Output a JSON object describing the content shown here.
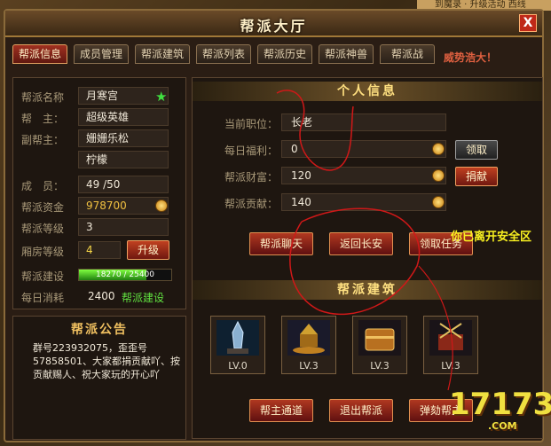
{
  "window": {
    "title": "帮派大厅",
    "close": "X"
  },
  "tabs": [
    "帮派信息",
    "成员管理",
    "帮派建筑",
    "帮派列表",
    "帮派历史",
    "帮派神兽",
    "帮派战"
  ],
  "banner_partial": "威势浩大！",
  "top_strip": "到魔录 · 升级活动 西线",
  "left": {
    "name": {
      "label": "帮派名称",
      "value": "月寒宫"
    },
    "leader": {
      "label": "帮　主：",
      "value": "超级英雄"
    },
    "vice": {
      "label": "副帮主：",
      "value1": "姗姗乐松",
      "value2": "柠檬"
    },
    "members": {
      "label": "成　员：",
      "value": "49 /50"
    },
    "funds": {
      "label": "帮派资金",
      "value": "978700"
    },
    "level": {
      "label": "帮派等级",
      "value": "3"
    },
    "room_level": {
      "label": "厢房等级",
      "value": "4",
      "button": "升级"
    },
    "construction": {
      "label": "帮派建设",
      "progress": 0.73,
      "text": "18270 / 25400"
    },
    "daily_cost": {
      "label": "每日消耗",
      "value": "2400",
      "link": "帮派建设"
    }
  },
  "notice": {
    "title": "帮派公告",
    "body": "群号223932075，歪歪号57858501、大家都捐贡献吖、按贡献赐人、祝大家玩的开心吖"
  },
  "personal": {
    "title": "个人信息",
    "position": {
      "label": "当前职位：",
      "value": "长老"
    },
    "welfare": {
      "label": "每日福利：",
      "value": "0",
      "button": "领取"
    },
    "wealth": {
      "label": "帮派财富：",
      "value": "120",
      "button": "捐献"
    },
    "contribution": {
      "label": "帮派贡献：",
      "value": "140"
    },
    "actions": [
      "帮派聊天",
      "返回长安",
      "领取任务"
    ]
  },
  "buildings": {
    "title": "帮派建筑",
    "items": [
      {
        "icon": "crystal-tower-icon",
        "level": "LV.0"
      },
      {
        "icon": "golden-pagoda-icon",
        "level": "LV.3"
      },
      {
        "icon": "treasure-chest-icon",
        "level": "LV.3"
      },
      {
        "icon": "weapon-rack-icon",
        "level": "LV.3"
      }
    ],
    "actions": [
      "帮主通道",
      "退出帮派",
      "弹劾帮主"
    ]
  },
  "alert": "你已离开安全区",
  "watermark": {
    "main": "17173",
    "sub": ".COM"
  },
  "colors": {
    "accent": "#b03820",
    "gold": "#ffe080",
    "panel": "#1e1610"
  }
}
